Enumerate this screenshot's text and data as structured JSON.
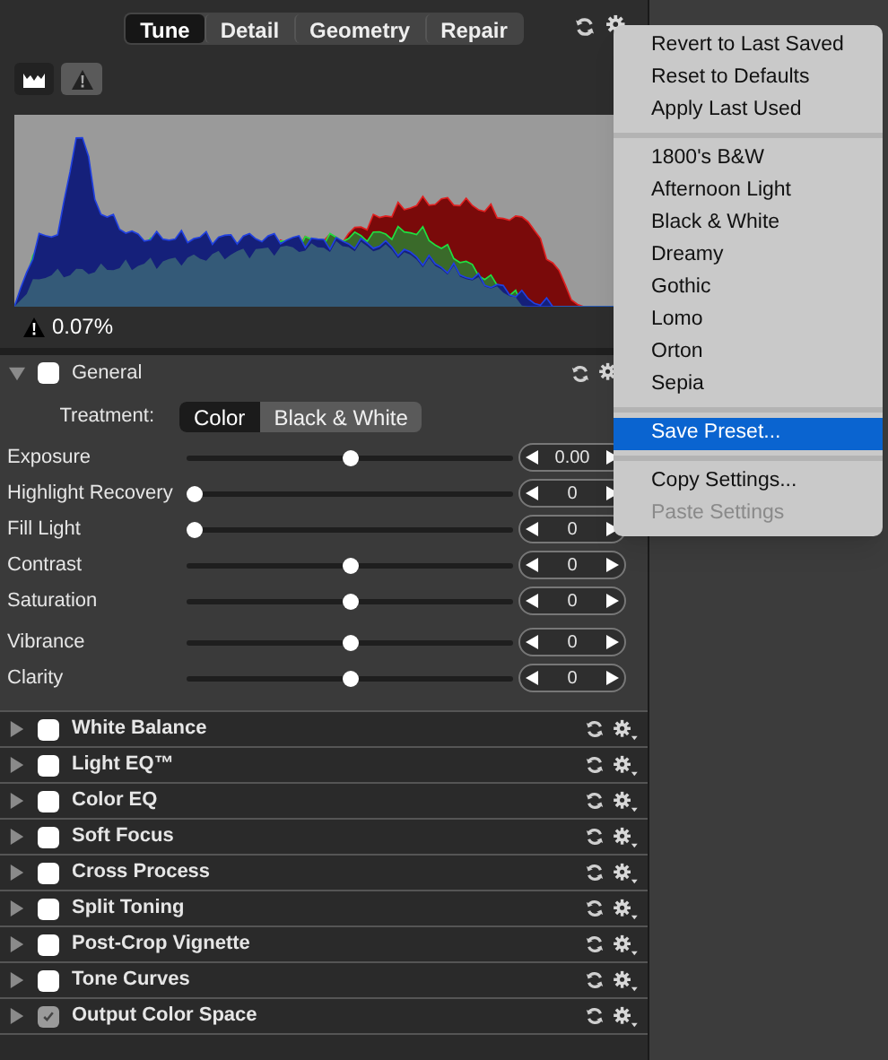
{
  "tabs": [
    {
      "label": "Tune",
      "selected": true
    },
    {
      "label": "Detail",
      "selected": false
    },
    {
      "label": "Geometry",
      "selected": false
    },
    {
      "label": "Repair",
      "selected": false
    }
  ],
  "histogram": {
    "clipping_warning": true,
    "clip_reading": "0.07%"
  },
  "general": {
    "label": "General",
    "expanded": true,
    "checked": false,
    "treatment": {
      "label": "Treatment:",
      "options": [
        {
          "label": "Color",
          "selected": true
        },
        {
          "label": "Black & White",
          "selected": false
        }
      ]
    },
    "sliders": [
      {
        "label": "Exposure",
        "level": 0.5,
        "reading": "0.00"
      },
      {
        "label": "Highlight Recovery",
        "level": 0,
        "reading": "0"
      },
      {
        "label": "Fill Light",
        "level": 0,
        "reading": "0"
      },
      {
        "label": "Contrast",
        "level": 0.5,
        "reading": "0"
      },
      {
        "label": "Saturation",
        "level": 0.5,
        "reading": "0"
      },
      {
        "label": "Vibrance",
        "level": 0.5,
        "reading": "0"
      },
      {
        "label": "Clarity",
        "level": 0.5,
        "reading": "0"
      }
    ]
  },
  "sections": [
    {
      "label": "White Balance",
      "expanded": false,
      "checked": false
    },
    {
      "label": "Light EQ™",
      "expanded": false,
      "checked": false
    },
    {
      "label": "Color EQ",
      "expanded": false,
      "checked": false
    },
    {
      "label": "Soft Focus",
      "expanded": false,
      "checked": false
    },
    {
      "label": "Cross Process",
      "expanded": false,
      "checked": false
    },
    {
      "label": "Split Toning",
      "expanded": false,
      "checked": false
    },
    {
      "label": "Post-Crop Vignette",
      "expanded": false,
      "checked": false
    },
    {
      "label": "Tone Curves",
      "expanded": false,
      "checked": false
    },
    {
      "label": "Output Color Space",
      "expanded": false,
      "checked": true
    }
  ],
  "menu": {
    "groups": [
      [
        {
          "label": "Revert to Last Saved",
          "selected": false,
          "disabled": false
        },
        {
          "label": "Reset to Defaults",
          "selected": false,
          "disabled": false
        },
        {
          "label": "Apply Last Used",
          "selected": false,
          "disabled": false
        }
      ],
      [
        {
          "label": "1800's B&W",
          "selected": false,
          "disabled": false
        },
        {
          "label": "Afternoon Light",
          "selected": false,
          "disabled": false
        },
        {
          "label": "Black & White",
          "selected": false,
          "disabled": false
        },
        {
          "label": "Dreamy",
          "selected": false,
          "disabled": false
        },
        {
          "label": "Gothic",
          "selected": false,
          "disabled": false
        },
        {
          "label": "Lomo",
          "selected": false,
          "disabled": false
        },
        {
          "label": "Orton",
          "selected": false,
          "disabled": false
        },
        {
          "label": "Sepia",
          "selected": false,
          "disabled": false
        }
      ],
      [
        {
          "label": "Save Preset...",
          "selected": true,
          "disabled": false
        }
      ],
      [
        {
          "label": "Copy Settings...",
          "selected": false,
          "disabled": false
        },
        {
          "label": "Paste Settings",
          "selected": false,
          "disabled": true
        }
      ]
    ]
  }
}
